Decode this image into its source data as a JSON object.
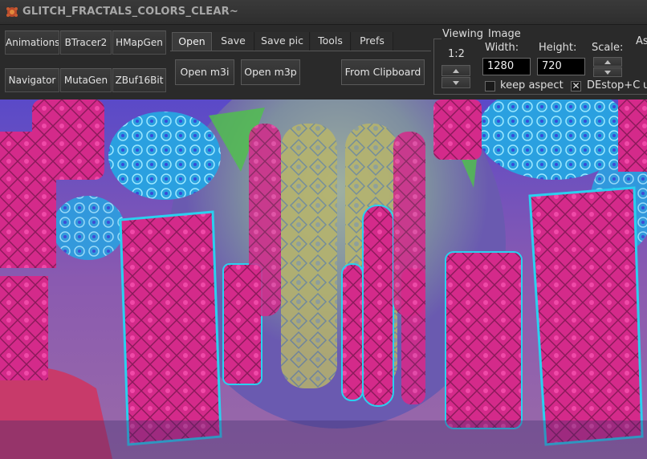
{
  "window": {
    "title": "GLITCH_FRACTALS_COLORS_CLEAR~",
    "icon": "mb3d-app-icon"
  },
  "modules": [
    {
      "label": "Animations"
    },
    {
      "label": "BTracer2"
    },
    {
      "label": "HMapGen"
    },
    {
      "label": "Navigator"
    },
    {
      "label": "MutaGen"
    },
    {
      "label": "ZBuf16Bit"
    }
  ],
  "tabs": [
    {
      "label": "Open",
      "active": true
    },
    {
      "label": "Save"
    },
    {
      "label": "Save pic"
    },
    {
      "label": "Tools"
    },
    {
      "label": "Prefs"
    }
  ],
  "open_panel": {
    "open_m3i": "Open m3i",
    "open_m3p": "Open m3p",
    "from_clipboard": "From Clipboard"
  },
  "viewing": {
    "label": "Viewing",
    "ratio": "1:2"
  },
  "image": {
    "label": "Image",
    "width_label": "Width:",
    "width_value": "1280",
    "height_label": "Height:",
    "height_value": "720",
    "scale_label": "Scale:",
    "keep_aspect_label": "keep aspect",
    "keep_aspect_checked": false,
    "destop_label": "DEstop+C",
    "destop_checked": true,
    "cut_label_right": "As",
    "cut_label_right2": "u"
  },
  "icons": {
    "checkmark": "✕"
  },
  "colors": {
    "window_bg": "#2b2b2b",
    "title_text": "#a8a8a8",
    "render_magenta": "#e0338f",
    "render_cyan": "#27c9e6",
    "render_blue": "#3a3cd8",
    "render_green": "#49c24a"
  }
}
